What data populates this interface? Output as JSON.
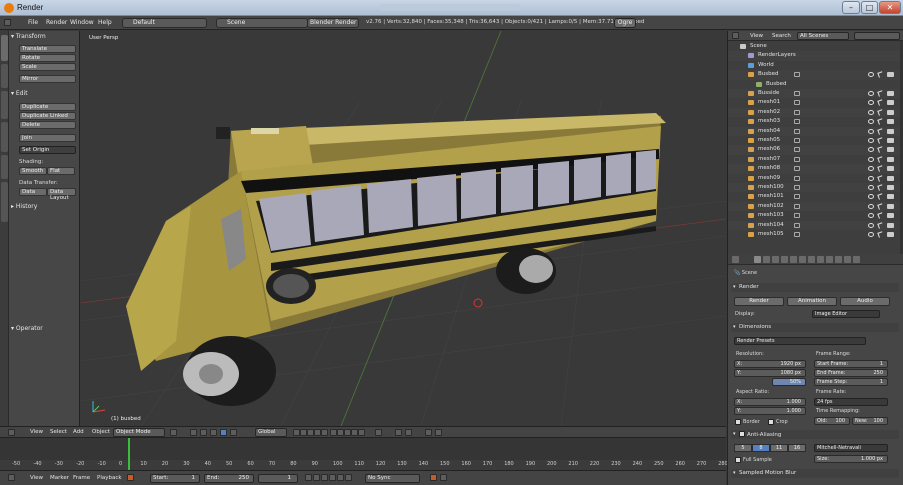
{
  "window": {
    "title": "Render",
    "controls": {
      "minimize": "–",
      "maximize": "□",
      "close": "✕"
    }
  },
  "infobar": {
    "menus": [
      "File",
      "Render",
      "Window",
      "Help"
    ],
    "layout": "Default",
    "scene": "Scene",
    "engine": "Blender Render",
    "stats": "v2.76 | Verts:32,840 | Faces:35,348 | Tris:36,643 | Objects:0/421 | Lamps:0/5 | Mem:37.71M | Busbed",
    "ogre": "Ogre"
  },
  "toolshelf": {
    "tabs": [
      "Tools",
      "Create",
      "Relations",
      "Animation",
      "Physics",
      "Grease Pencil"
    ],
    "transform_header": "Transform",
    "transform_buttons": [
      "Translate",
      "Rotate",
      "Scale"
    ],
    "mirror": "Mirror",
    "edit_header": "Edit",
    "edit_buttons": [
      "Duplicate",
      "Duplicate Linked",
      "Delete"
    ],
    "join": "Join",
    "set_origin": "Set Origin",
    "shading_label": "Shading:",
    "smooth": "Smooth",
    "flat": "Flat",
    "data_transfer_label": "Data Transfer:",
    "data": "Data",
    "data_layout": "Data Layout",
    "history_header": "History",
    "operator_header": "Operator"
  },
  "viewport": {
    "label": "User Persp",
    "object_label": "(1) busbed"
  },
  "viewport_header": {
    "menus": [
      "View",
      "Select",
      "Add",
      "Object"
    ],
    "mode": "Object Mode",
    "orientation": "Global"
  },
  "timeline": {
    "ticks": [
      "-50",
      "-40",
      "-30",
      "-20",
      "-10",
      "0",
      "10",
      "20",
      "30",
      "40",
      "50",
      "60",
      "70",
      "80",
      "90",
      "100",
      "110",
      "120",
      "130",
      "140",
      "150",
      "160",
      "170",
      "180",
      "190",
      "200",
      "210",
      "220",
      "230",
      "240",
      "250",
      "260",
      "270",
      "280"
    ],
    "current_frame": 0,
    "menus": [
      "View",
      "Marker",
      "Frame",
      "Playback"
    ],
    "start_label": "Start:",
    "start_value": "1",
    "end_label": "End:",
    "end_value": "250",
    "current_value": "1",
    "sync": "No Sync"
  },
  "outliner": {
    "menus": [
      "View",
      "Search"
    ],
    "filter": "All Scenes",
    "rows": [
      {
        "label": "Scene",
        "indent": 0,
        "type": "scene"
      },
      {
        "label": "RenderLayers",
        "indent": 1,
        "type": "layer"
      },
      {
        "label": "World",
        "indent": 1,
        "type": "world"
      },
      {
        "label": "Busbed",
        "indent": 1,
        "type": "mesh"
      },
      {
        "label": "Busbed",
        "indent": 2,
        "type": "data"
      },
      {
        "label": "Busside",
        "indent": 1,
        "type": "mesh"
      },
      {
        "label": "mesh01",
        "indent": 1,
        "type": "mesh"
      },
      {
        "label": "mesh02",
        "indent": 1,
        "type": "mesh"
      },
      {
        "label": "mesh03",
        "indent": 1,
        "type": "mesh"
      },
      {
        "label": "mesh04",
        "indent": 1,
        "type": "mesh"
      },
      {
        "label": "mesh05",
        "indent": 1,
        "type": "mesh"
      },
      {
        "label": "mesh06",
        "indent": 1,
        "type": "mesh"
      },
      {
        "label": "mesh07",
        "indent": 1,
        "type": "mesh"
      },
      {
        "label": "mesh08",
        "indent": 1,
        "type": "mesh"
      },
      {
        "label": "mesh09",
        "indent": 1,
        "type": "mesh"
      },
      {
        "label": "mesh100",
        "indent": 1,
        "type": "mesh"
      },
      {
        "label": "mesh101",
        "indent": 1,
        "type": "mesh"
      },
      {
        "label": "mesh102",
        "indent": 1,
        "type": "mesh"
      },
      {
        "label": "mesh103",
        "indent": 1,
        "type": "mesh"
      },
      {
        "label": "mesh104",
        "indent": 1,
        "type": "mesh"
      },
      {
        "label": "mesh105",
        "indent": 1,
        "type": "mesh"
      }
    ]
  },
  "properties": {
    "breadcrumb": "Scene",
    "render_header": "Render",
    "render_button": "Render",
    "animation_button": "Animation",
    "audio_button": "Audio",
    "display_label": "Display:",
    "display_value": "Image Editor",
    "dimensions_header": "Dimensions",
    "render_presets": "Render Presets",
    "resolution_label": "Resolution:",
    "res_x_label": "X:",
    "res_x": "1920 px",
    "res_y_label": "Y:",
    "res_y": "1080 px",
    "res_pct": "50%",
    "frame_range_label": "Frame Range:",
    "start_frame_label": "Start Frame:",
    "start_frame": "1",
    "end_frame_label": "End Frame:",
    "end_frame": "250",
    "frame_step_label": "Frame Step:",
    "frame_step": "1",
    "aspect_label": "Aspect Ratio:",
    "asp_x_label": "X:",
    "asp_x": "1.000",
    "asp_y_label": "Y:",
    "asp_y": "1.000",
    "frame_rate_label": "Frame Rate:",
    "frame_rate": "24 fps",
    "time_remap_label": "Time Remapping:",
    "old_label": "Old:",
    "old_value": "100",
    "new_label": "New:",
    "new_value": "100",
    "border_label": "Border",
    "crop_label": "Crop",
    "aa_header": "Anti-Aliasing",
    "aa_samples": [
      "5",
      "8",
      "11",
      "16"
    ],
    "aa_selected": 1,
    "aa_filter": "Mitchell-Netravali",
    "full_sample": "Full Sample",
    "size_label": "Size:",
    "size_value": "1.000 px",
    "motion_blur": "Sampled Motion Blur"
  }
}
